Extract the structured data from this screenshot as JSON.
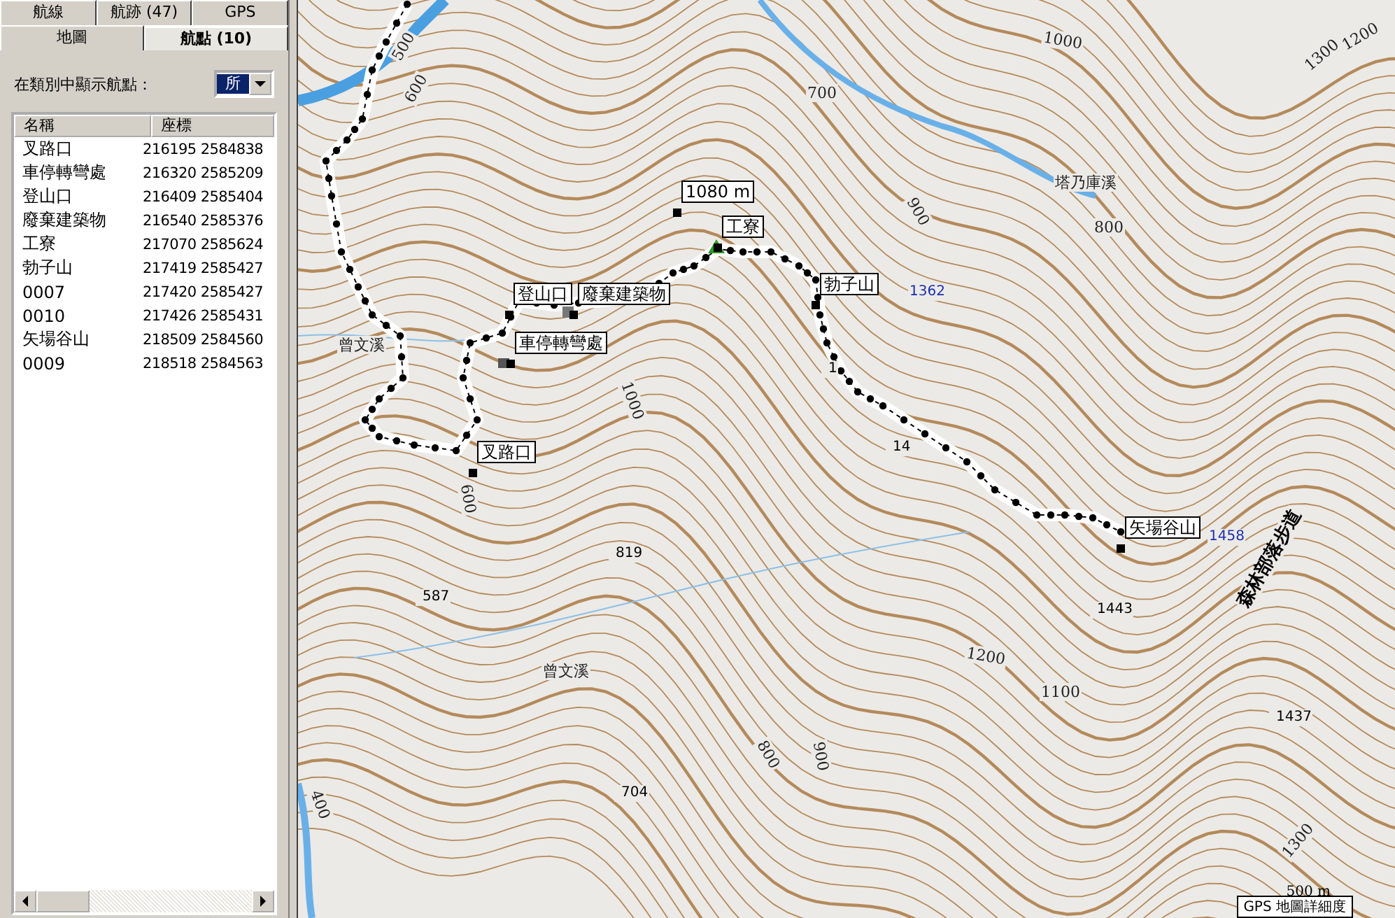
{
  "tabs": {
    "back_row": [
      {
        "label": "航線",
        "selected": false
      },
      {
        "label": "航跡 (47)",
        "selected": false
      },
      {
        "label": "GPS",
        "selected": false
      }
    ],
    "front_row": [
      {
        "label": "地圖",
        "selected": false
      },
      {
        "label": "航點 (10)",
        "selected": true
      }
    ]
  },
  "filter": {
    "label": "在類別中顯示航點：",
    "value": "所"
  },
  "table": {
    "columns": [
      "名稱",
      "座標"
    ],
    "rows": [
      [
        "叉路口",
        "216195 2584838"
      ],
      [
        "車停轉彎處",
        "216320 2585209"
      ],
      [
        "登山口",
        "216409 2585404"
      ],
      [
        "廢棄建築物",
        "216540 2585376"
      ],
      [
        "工寮",
        "217070 2585624"
      ],
      [
        "勃子山",
        "217419 2585427"
      ],
      [
        "0007",
        "217420 2585427"
      ],
      [
        "0010",
        "217426 2585431"
      ],
      [
        "矢場谷山",
        "218509 2584560"
      ],
      [
        "0009",
        "218518 2584563"
      ]
    ]
  },
  "map": {
    "labels": [
      {
        "kind": "elevation",
        "text": "1080 m"
      },
      {
        "kind": "waypoint",
        "text": "工寮"
      },
      {
        "kind": "waypoint",
        "text": "勃子山"
      },
      {
        "kind": "waypoint",
        "text": "登山口"
      },
      {
        "kind": "waypoint",
        "text": "廢棄建築物"
      },
      {
        "kind": "waypoint",
        "text": "車停轉彎處"
      },
      {
        "kind": "waypoint",
        "text": "叉路口"
      },
      {
        "kind": "waypoint",
        "text": "矢場谷山"
      },
      {
        "kind": "peak",
        "text": "1362"
      },
      {
        "kind": "peak",
        "text": "1458"
      },
      {
        "kind": "contour",
        "text": "500"
      },
      {
        "kind": "contour",
        "text": "600"
      },
      {
        "kind": "contour",
        "text": "700"
      },
      {
        "kind": "contour",
        "text": "1000"
      },
      {
        "kind": "contour",
        "text": "1300"
      },
      {
        "kind": "contour",
        "text": "1200"
      },
      {
        "kind": "contour",
        "text": "900"
      },
      {
        "kind": "contour",
        "text": "800"
      },
      {
        "kind": "contour",
        "text": "1000"
      },
      {
        "kind": "contour",
        "text": "600"
      },
      {
        "kind": "contour",
        "text": "400"
      },
      {
        "kind": "contour",
        "text": "800"
      },
      {
        "kind": "contour",
        "text": "900"
      },
      {
        "kind": "contour",
        "text": "1200"
      },
      {
        "kind": "contour",
        "text": "1100"
      },
      {
        "kind": "contour",
        "text": "1300"
      },
      {
        "kind": "spot",
        "text": "819"
      },
      {
        "kind": "spot",
        "text": "587"
      },
      {
        "kind": "spot",
        "text": "704"
      },
      {
        "kind": "spot",
        "text": "1443"
      },
      {
        "kind": "spot",
        "text": "1437"
      },
      {
        "kind": "spot",
        "text": "1"
      },
      {
        "kind": "spot",
        "text": "14"
      },
      {
        "kind": "river",
        "text": "曾文溪"
      },
      {
        "kind": "river",
        "text": "曾文溪"
      },
      {
        "kind": "river",
        "text": "塔乃庫溪"
      },
      {
        "kind": "trail",
        "text": "森林部落步道"
      }
    ],
    "scale": "500 m",
    "footer": "GPS 地圖詳細度"
  }
}
